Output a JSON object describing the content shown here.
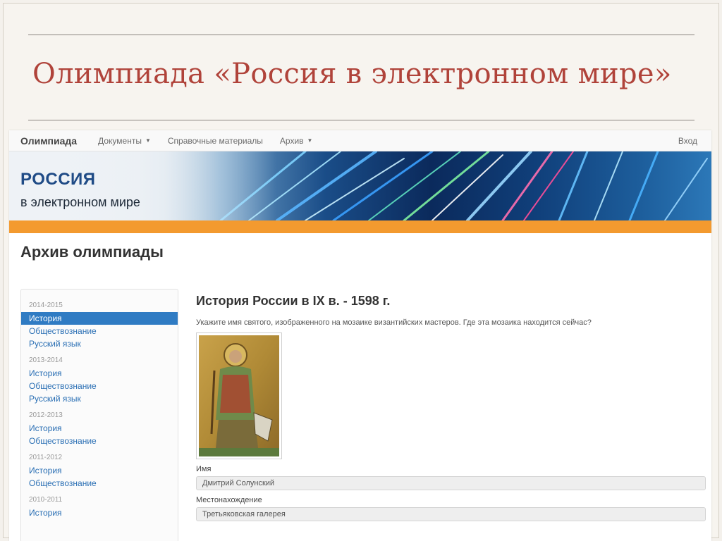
{
  "slide": {
    "title": "Олимпиада «Россия в электронном мире»"
  },
  "navbar": {
    "brand": "Олимпиада",
    "items": [
      {
        "label": "Документы"
      },
      {
        "label": "Справочные материалы"
      },
      {
        "label": "Архив"
      }
    ],
    "login": "Вход"
  },
  "banner": {
    "title": "РОССИЯ",
    "subtitle": "в электронном мире"
  },
  "page": {
    "heading": "Архив олимпиады"
  },
  "sidebar": {
    "groups": [
      {
        "year": "2014-2015",
        "items": [
          "История",
          "Обществознание",
          "Русский язык"
        ]
      },
      {
        "year": "2013-2014",
        "items": [
          "История",
          "Обществознание",
          "Русский язык"
        ]
      },
      {
        "year": "2012-2013",
        "items": [
          "История",
          "Обществознание"
        ]
      },
      {
        "year": "2011-2012",
        "items": [
          "История",
          "Обществознание"
        ]
      },
      {
        "year": "2010-2011",
        "items": [
          "История"
        ]
      }
    ],
    "active": "История"
  },
  "question": {
    "title": "История России в IX в. - 1598 г.",
    "text": "Укажите имя святого, изображенного на мозаике византийских мастеров. Где эта мозаика находится сейчас?",
    "fields": [
      {
        "label": "Имя",
        "value": "Дмитрий Солунский"
      },
      {
        "label": "Местонахождение",
        "value": "Третьяковская галерея"
      }
    ]
  },
  "colors": {
    "slide_title": "#b0433a",
    "link": "#2a6fb4",
    "active_bg": "#2f7bc3",
    "banner_orange": "#f39a2f"
  }
}
